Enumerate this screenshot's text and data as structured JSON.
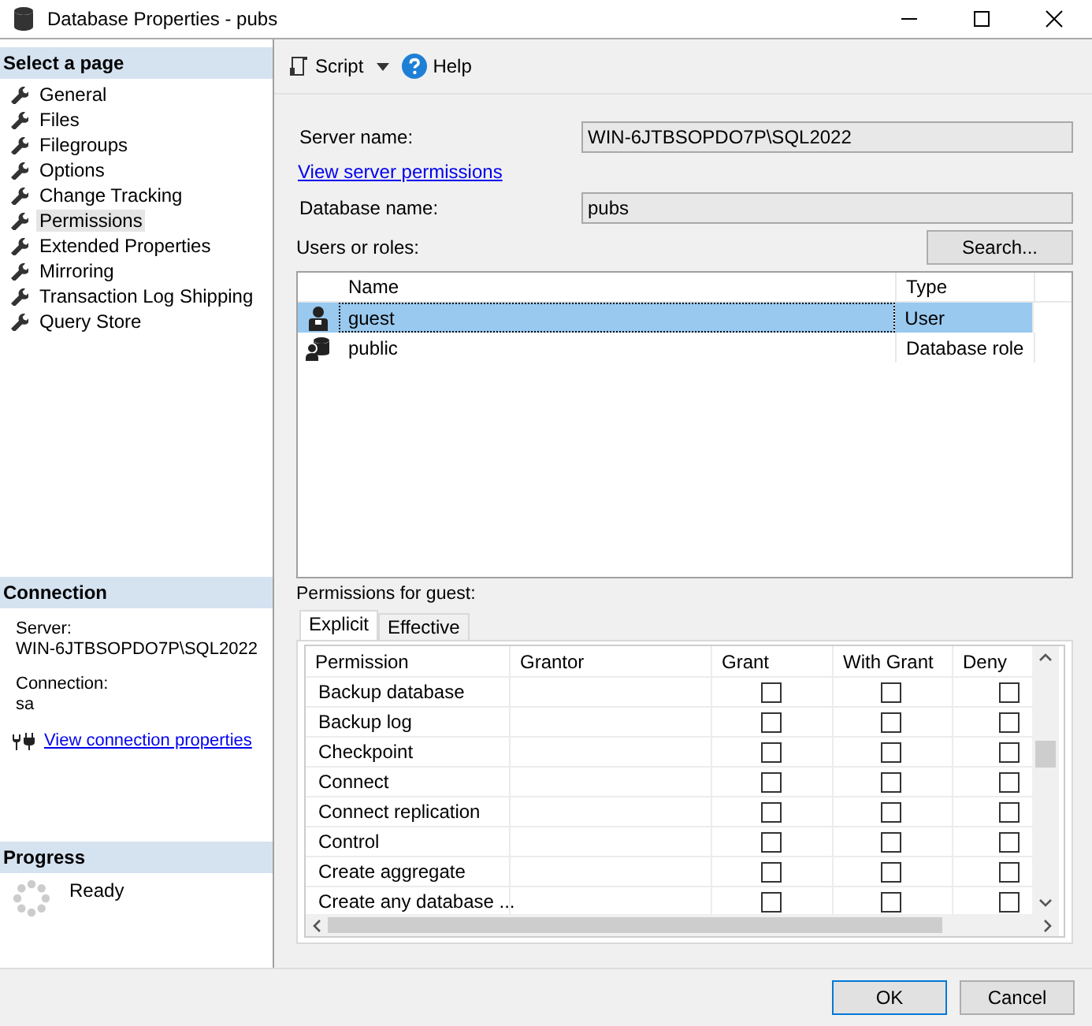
{
  "window": {
    "title": "Database Properties - pubs"
  },
  "sidebar": {
    "header": "Select a page",
    "items": [
      {
        "label": "General",
        "selected": false
      },
      {
        "label": "Files",
        "selected": false
      },
      {
        "label": "Filegroups",
        "selected": false
      },
      {
        "label": "Options",
        "selected": false
      },
      {
        "label": "Change Tracking",
        "selected": false
      },
      {
        "label": "Permissions",
        "selected": true
      },
      {
        "label": "Extended Properties",
        "selected": false
      },
      {
        "label": "Mirroring",
        "selected": false
      },
      {
        "label": "Transaction Log Shipping",
        "selected": false
      },
      {
        "label": "Query Store",
        "selected": false
      }
    ]
  },
  "connection": {
    "header": "Connection",
    "server_label": "Server:",
    "server": "WIN-6JTBSOPDO7P\\SQL2022",
    "connection_label": "Connection:",
    "connection": "sa",
    "link": "View connection properties"
  },
  "progress": {
    "header": "Progress",
    "status": "Ready"
  },
  "toolbar": {
    "script": "Script",
    "help": "Help"
  },
  "form": {
    "server_name_label": "Server name:",
    "server_name": "WIN-6JTBSOPDO7P\\SQL2022",
    "server_permissions_link": "View server permissions",
    "database_name_label": "Database name:",
    "database_name": "pubs",
    "users_label": "Users or roles:",
    "search_button": "Search..."
  },
  "users_table": {
    "columns": [
      "Name",
      "Type"
    ],
    "rows": [
      {
        "kind": "user",
        "name": "guest",
        "type": "User",
        "selected": true
      },
      {
        "kind": "role",
        "name": "public",
        "type": "Database role",
        "selected": false
      }
    ]
  },
  "permissions": {
    "label": "Permissions for guest:",
    "tabs": [
      {
        "label": "Explicit",
        "selected": true
      },
      {
        "label": "Effective",
        "selected": false
      }
    ],
    "columns": [
      "Permission",
      "Grantor",
      "Grant",
      "With Grant",
      "Deny"
    ],
    "rows": [
      {
        "permission": "Backup database",
        "grant": false,
        "with_grant": false,
        "deny": false
      },
      {
        "permission": "Backup log",
        "grant": false,
        "with_grant": false,
        "deny": false
      },
      {
        "permission": "Checkpoint",
        "grant": false,
        "with_grant": false,
        "deny": false
      },
      {
        "permission": "Connect",
        "grant": false,
        "with_grant": false,
        "deny": false
      },
      {
        "permission": "Connect replication",
        "grant": false,
        "with_grant": false,
        "deny": false
      },
      {
        "permission": "Control",
        "grant": false,
        "with_grant": false,
        "deny": false
      },
      {
        "permission": "Create aggregate",
        "grant": false,
        "with_grant": false,
        "deny": false
      },
      {
        "permission": "Create any database ...",
        "grant": false,
        "with_grant": false,
        "deny": false
      }
    ]
  },
  "buttons": [
    {
      "label": "OK",
      "default": true
    },
    {
      "label": "Cancel",
      "default": false
    }
  ]
}
